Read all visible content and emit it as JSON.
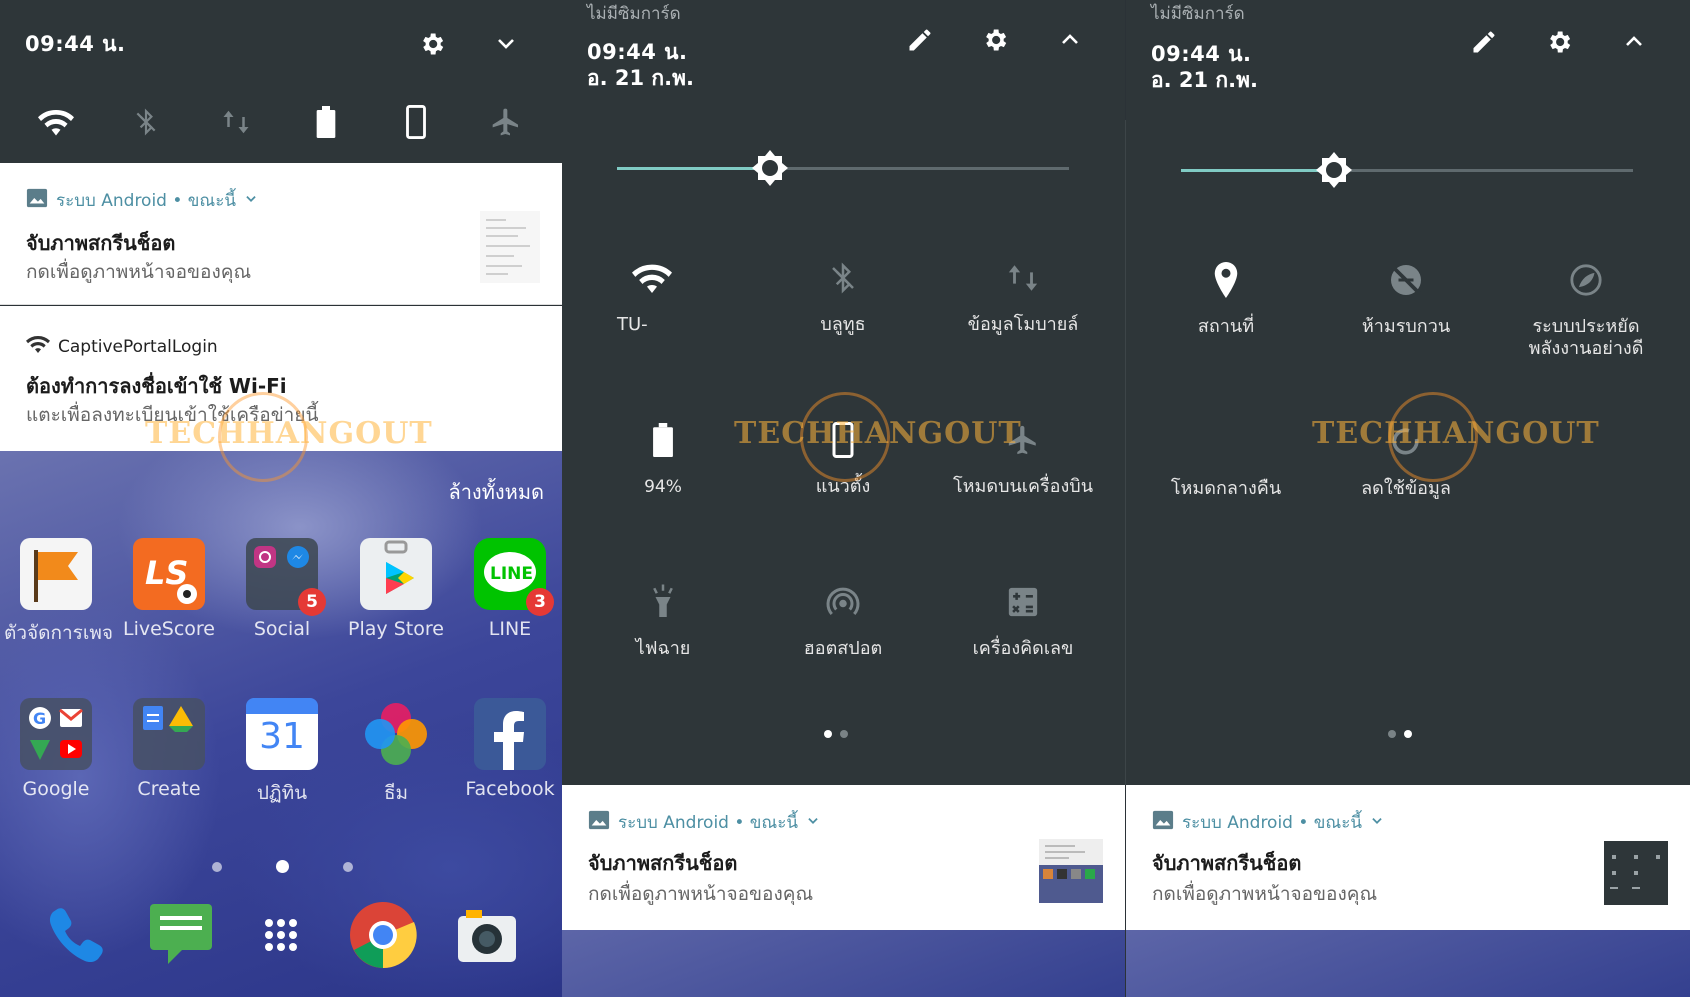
{
  "panel1": {
    "time": "09:44 น.",
    "notifications": [
      {
        "app": "ระบบ Android • ขณะนี้",
        "title": "จับภาพสกรีนช็อต",
        "text": "กดเพื่อดูภาพหน้าจอของคุณ"
      },
      {
        "app": "CaptivePortalLogin",
        "title": "ต้องทำการลงชื่อเข้าใช้ Wi-Fi",
        "text": "แตะเพื่อลงทะเบียนเข้าใช้เครือข่ายนี้"
      }
    ],
    "clear_all": "ล้างทั้งหมด",
    "apps_row1": [
      {
        "label": "ตัวจัดการเพจ",
        "icon": "flag-icon"
      },
      {
        "label": "LiveScore",
        "icon": "livescore-icon"
      },
      {
        "label": "Social",
        "icon": "social-folder-icon",
        "badge": "5"
      },
      {
        "label": "Play Store",
        "icon": "play-store-icon"
      },
      {
        "label": "LINE",
        "icon": "line-icon",
        "badge": "3"
      }
    ],
    "apps_row2": [
      {
        "label": "Google",
        "icon": "google-folder-icon"
      },
      {
        "label": "Create",
        "icon": "create-folder-icon"
      },
      {
        "label": "ปฏิทิน",
        "icon": "calendar-icon",
        "day": "31"
      },
      {
        "label": "ธีม",
        "icon": "themes-icon"
      },
      {
        "label": "Facebook",
        "icon": "facebook-icon"
      }
    ]
  },
  "panel2": {
    "no_sim": "ไม่มีซิมการ์ด",
    "time": "09:44 น.",
    "date": "อ. 21 ก.พ.",
    "tiles": [
      {
        "label": "TU-",
        "icon": "wifi-icon"
      },
      {
        "label": "บลูทูธ",
        "icon": "bluetooth-off-icon"
      },
      {
        "label": "ข้อมูลโมบายล์",
        "icon": "mobile-data-icon"
      },
      {
        "label": "94%",
        "icon": "battery-icon"
      },
      {
        "label": "แนวตั้ง",
        "icon": "portrait-icon"
      },
      {
        "label": "โหมดบนเครื่องบิน",
        "icon": "airplane-icon"
      },
      {
        "label": "ไฟฉาย",
        "icon": "flashlight-icon"
      },
      {
        "label": "ฮอตสปอต",
        "icon": "hotspot-icon"
      },
      {
        "label": "เครื่องคิดเลข",
        "icon": "calculator-icon"
      }
    ],
    "notification": {
      "app": "ระบบ Android • ขณะนี้",
      "title": "จับภาพสกรีนช็อต",
      "text": "กดเพื่อดูภาพหน้าจอของคุณ"
    }
  },
  "panel3": {
    "no_sim": "ไม่มีซิมการ์ด",
    "time": "09:44 น.",
    "date": "อ. 21 ก.พ.",
    "tiles": [
      {
        "label": "สถานที่",
        "icon": "location-icon"
      },
      {
        "label": "ห้ามรบกวน",
        "icon": "do-not-disturb-icon"
      },
      {
        "label": "ระบบประหยัด\nพลังงานอย่างดี",
        "icon": "battery-saver-icon"
      },
      {
        "label": "โหมดกลางคืน",
        "icon": "night-mode-icon"
      },
      {
        "label": "ลดใช้ข้อมูล",
        "icon": "data-saver-icon"
      }
    ],
    "notification": {
      "app": "ระบบ Android • ขณะนี้",
      "title": "จับภาพสกรีนช็อต",
      "text": "กดเพื่อดูภาพหน้าจอของคุณ"
    }
  },
  "watermark": "TECHHANGOUT",
  "brightness_level": 0.33
}
